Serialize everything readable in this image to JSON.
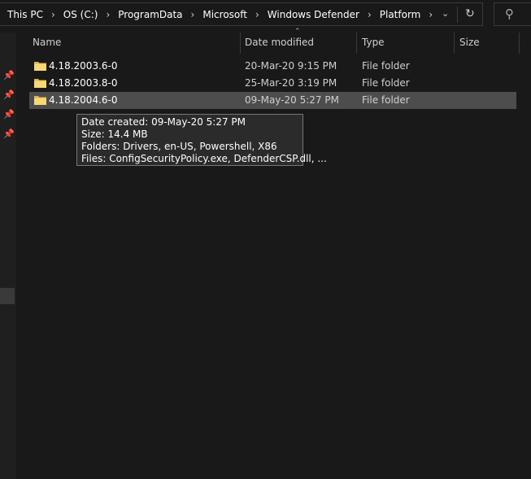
{
  "breadcrumbs": [
    "This PC",
    "OS (C:)",
    "ProgramData",
    "Microsoft",
    "Windows Defender",
    "Platform"
  ],
  "icons": {
    "separator": "chevron-right-icon",
    "dropdown": "chevron-down-icon",
    "refresh": "refresh-icon",
    "search": "search-icon",
    "pin": "pin-icon",
    "folder": "folder-icon"
  },
  "columns": {
    "name": "Name",
    "date": "Date modified",
    "type": "Type",
    "size": "Size"
  },
  "files": [
    {
      "name": "4.18.2003.6-0",
      "date": "20-Mar-20 9:15 PM",
      "type": "File folder",
      "size": ""
    },
    {
      "name": "4.18.2003.8-0",
      "date": "25-Mar-20 3:19 PM",
      "type": "File folder",
      "size": ""
    },
    {
      "name": "4.18.2004.6-0",
      "date": "09-May-20 5:27 PM",
      "type": "File folder",
      "size": "",
      "selected": true
    }
  ],
  "tooltip": {
    "line1": "Date created: 09-May-20 5:27 PM",
    "line2": "Size: 14.4 MB",
    "line3": "Folders: Drivers, en-US, Powershell, X86",
    "line4": "Files: ConfigSecurityPolicy.exe, DefenderCSP.dll, ..."
  },
  "colors": {
    "background": "#191919",
    "selection": "#4d4d4d",
    "folder": "#f8d775"
  }
}
